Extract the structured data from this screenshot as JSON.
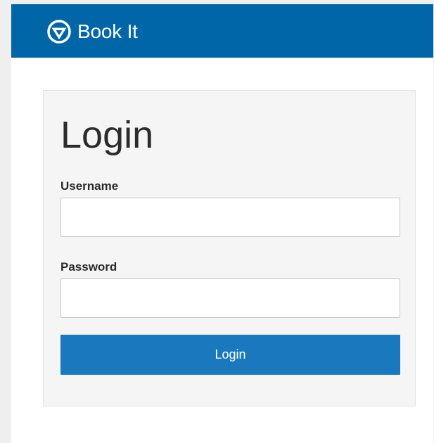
{
  "header": {
    "brand_name": "Book It",
    "brand_icon": "gvsu-logo-icon",
    "background_color": "#0066a8"
  },
  "login_card": {
    "title": "Login",
    "username": {
      "label": "Username",
      "value": "",
      "placeholder": ""
    },
    "password": {
      "label": "Password",
      "value": "",
      "placeholder": ""
    },
    "submit_label": "Login",
    "button_color": "#1a79be"
  }
}
